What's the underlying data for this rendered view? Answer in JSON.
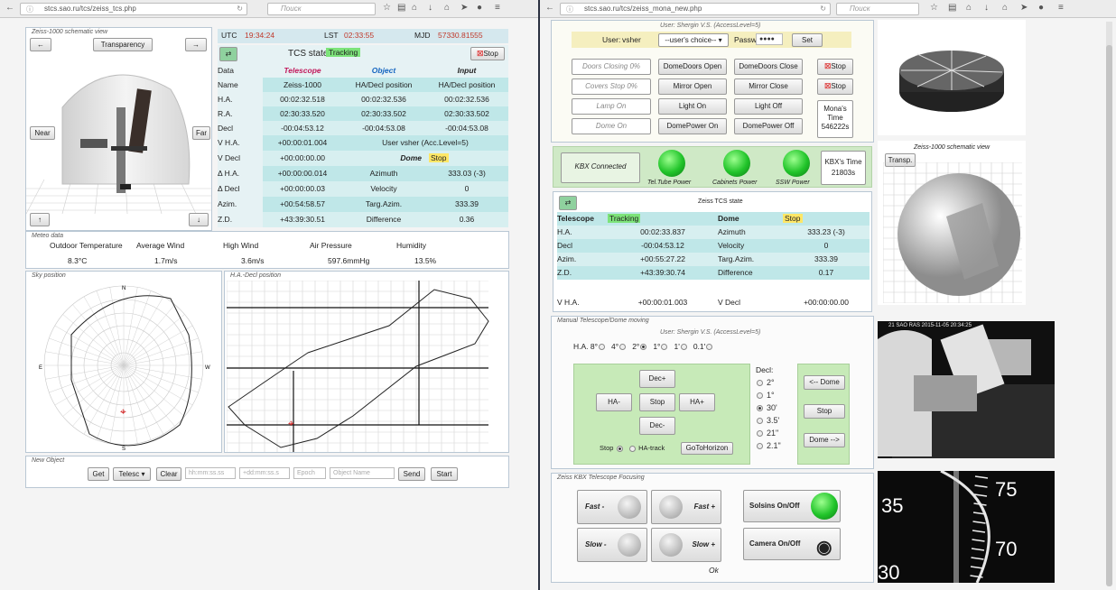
{
  "left": {
    "url": "stcs.sao.ru/tcs/zeiss_tcs.php",
    "search_placeholder": "Поиск",
    "schematic": {
      "title": "Zeiss-1000 schematic view",
      "transparency": "Transparency",
      "near": "Near",
      "far": "Far"
    },
    "time": {
      "utc_label": "UTC",
      "utc": "19:34:24",
      "lst_label": "LST",
      "lst": "02:33:55",
      "mjd_label": "MJD",
      "mjd": "57330.81555"
    },
    "tcs_state_label": "TCS state",
    "tcs_state": "Tracking",
    "stop": "Stop",
    "headers": [
      "Data",
      "Telescope",
      "Object",
      "Input"
    ],
    "rows": [
      [
        "Name",
        "Zeiss-1000",
        "HA/Decl position",
        "HA/Decl position"
      ],
      [
        "H.A.",
        "00:02:32.518",
        "00:02:32.536",
        "00:02:32.536"
      ],
      [
        "R.A.",
        "02:30:33.520",
        "02:30:33.502",
        "02:30:33.502"
      ],
      [
        "Decl",
        "-00:04:53.12",
        "-00:04:53.08",
        "-00:04:53.08"
      ]
    ],
    "lower": [
      [
        "V H.A.",
        "+00:00:01.004",
        "User vsher (Acc.Level=5)",
        ""
      ],
      [
        "V Decl",
        "+00:00:00.00",
        "Dome",
        "Stop"
      ],
      [
        "Δ H.A.",
        "+00:00:00.014",
        "Azimuth",
        "333.03 (-3)"
      ],
      [
        "Δ Decl",
        "+00:00:00.03",
        "Velocity",
        "0"
      ],
      [
        "Azim.",
        "+00:54:58.57",
        "Targ.Azim.",
        "333.39"
      ],
      [
        "Z.D.",
        "+43:39:30.51",
        "Difference",
        "0.36"
      ]
    ],
    "meteo": {
      "title": "Meteo data",
      "labels": [
        "Outdoor Temperature",
        "Average Wind",
        "High Wind",
        "Air Pressure",
        "Humidity"
      ],
      "values": [
        "8.3°C",
        "1.7m/s",
        "3.6m/s",
        "597.6mmHg",
        "13.5%"
      ]
    },
    "sky_title": "Sky position",
    "sky_dirs": [
      "N",
      "E",
      "W",
      "S"
    ],
    "hadec_title": "H.A.-Decl position",
    "newobj": {
      "title": "New Object",
      "get": "Get",
      "telesc": "Telesc",
      "clear": "Clear",
      "ph1": "hh:mm:ss.ss",
      "ph2": "+dd:mm:ss.s",
      "ph3": "Epoch",
      "ph4": "Object Name",
      "send": "Send",
      "start": "Start"
    }
  },
  "right": {
    "url": "stcs.sao.ru/tcs/zeiss_mona_new.php",
    "search_placeholder": "Поиск",
    "user_title": "User: Shergin V.S. (AccessLevel=5)",
    "user_label": "User:",
    "user": "vsher",
    "user_choice": "--user's choice--",
    "passw_label": "Passw",
    "passw": "●●●●",
    "set": "Set",
    "status": [
      "Doors Closing 0%",
      "Covers Stop 0%",
      "Lamp On",
      "Dome On"
    ],
    "col1": [
      "DomeDoors Open",
      "Mirror Open",
      "Light On",
      "DomePower On"
    ],
    "col2": [
      "DomeDoors Close",
      "Mirror Close",
      "Light Off",
      "DomePower Off"
    ],
    "stops": [
      "Stop",
      "Stop"
    ],
    "mona_time": "Mona's Time 546222s",
    "kbx_connected": "KBX Connected",
    "kbx_time": "KBX's Time 21803s",
    "power": [
      "Tel.Tube Power",
      "Cabinets Power",
      "SSW Power"
    ],
    "tcs_title": "Zeiss TCS state",
    "tcs_rows": [
      [
        "Telescope",
        "Tracking",
        "Dome",
        "Stop"
      ],
      [
        "H.A.",
        "00:02:33.837",
        "Azimuth",
        "333.23 (-3)"
      ],
      [
        "Decl",
        "-00:04:53.12",
        "Velocity",
        "0"
      ],
      [
        "Azim.",
        "+00:55:27.22",
        "Targ.Azim.",
        "333.39"
      ],
      [
        "Z.D.",
        "+43:39:30.74",
        "Difference",
        "0.17"
      ],
      [
        "V H.A.",
        "+00:00:01.003",
        "V Decl",
        "+00:00:00.00"
      ]
    ],
    "schematic_title": "Zeiss-1000 schematic view",
    "transp": "Transp.",
    "manual_title": "Manual Telescope/Dome moving",
    "manual_user": "User: Shergin V.S. (AccessLevel=5)",
    "ha_label": "H.A.",
    "ha_speeds": [
      "8°",
      "4°",
      "2°",
      "1°",
      "1'",
      "0.1'"
    ],
    "dir": {
      "dec_plus": "Dec+",
      "ha_minus": "HA-",
      "stop": "Stop",
      "ha_plus": "HA+",
      "dec_minus": "Dec-",
      "stop_radio": "Stop",
      "ha_track": "HA-track",
      "goto": "GoToHorizon"
    },
    "decl_label": "Decl:",
    "decl_speeds": [
      "2°",
      "1°",
      "30'",
      "3.5'",
      "21\"",
      "2.1\""
    ],
    "dome": {
      "left": "<-- Dome",
      "stop": "Stop",
      "right": "Dome -->"
    },
    "focus_title": "Zeiss KBX Telescope Focusing",
    "focus": [
      "Fast -",
      "Fast +",
      "Slow -",
      "Slow +"
    ],
    "ok": "Ok",
    "solsins": "Solsins On/Off",
    "camera": "Camera On/Off",
    "cam_stamp": "21 SAO RAS 2015-11-05 20:34:25",
    "dial": [
      "35",
      "75",
      "30",
      "70"
    ]
  }
}
